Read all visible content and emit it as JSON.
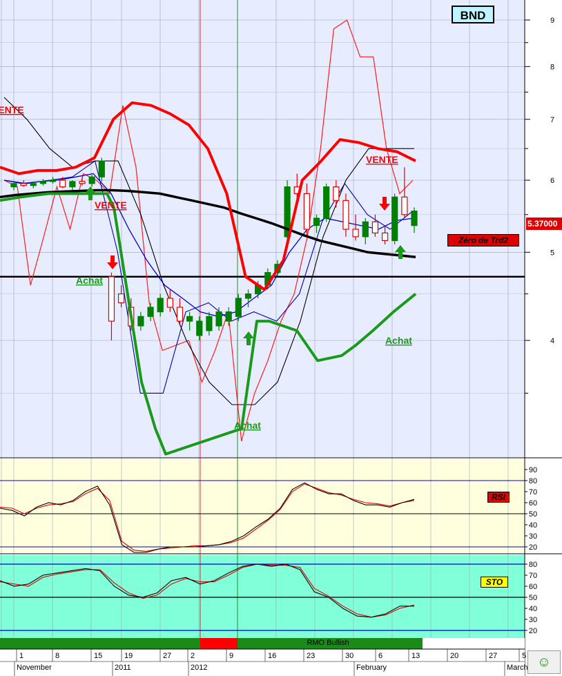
{
  "ticker": "BND",
  "last_price_label": "5.37000",
  "zero_label": "Zéro de Trd2",
  "rsi_label": "RSI",
  "sto_label": "STO",
  "rmo_label": "RMO Bullish",
  "signal_labels": {
    "vente": "VENTE",
    "achat": "Achat"
  },
  "colors": {
    "price_bg": "#e8ecff",
    "rsi_bg": "#ffffdd",
    "sto_bg": "#80ffd8",
    "bull": "#008000",
    "bear": "#e00000",
    "ma_black": "#000000",
    "ma_blue": "#0000cc"
  },
  "x_axis": {
    "ticks": [
      "1",
      "8",
      "15",
      "19",
      "27",
      "2",
      "9",
      "16",
      "23",
      "30",
      "6",
      "13",
      "20",
      "27",
      "5"
    ],
    "months": [
      "November",
      "2011",
      "2012",
      "February",
      "March"
    ]
  },
  "chart_data": [
    {
      "type": "line",
      "panel": "price",
      "title": "BND",
      "y_scale": "log",
      "ylim": [
        3.3,
        9.5
      ],
      "y_ticks": [
        4,
        5,
        6,
        7,
        8,
        9
      ],
      "last_price": 5.37,
      "support_level": 4.7,
      "candles": [
        [
          5.9,
          5.98,
          5.85,
          5.95
        ],
        [
          5.95,
          6.0,
          5.9,
          5.92
        ],
        [
          5.92,
          5.98,
          5.88,
          5.95
        ],
        [
          5.95,
          6.02,
          5.92,
          5.98
        ],
        [
          5.98,
          6.05,
          5.95,
          6.0
        ],
        [
          6.0,
          6.05,
          5.88,
          5.9
        ],
        [
          5.9,
          6.0,
          5.85,
          5.98
        ],
        [
          5.98,
          6.05,
          5.92,
          5.95
        ],
        [
          5.95,
          6.08,
          5.9,
          6.05
        ],
        [
          6.05,
          6.35,
          5.98,
          6.3
        ],
        [
          4.7,
          4.75,
          4.0,
          4.2
        ],
        [
          4.5,
          4.6,
          4.35,
          4.4
        ],
        [
          4.35,
          4.45,
          4.1,
          4.15
        ],
        [
          4.15,
          4.3,
          4.1,
          4.25
        ],
        [
          4.25,
          4.4,
          4.2,
          4.35
        ],
        [
          4.3,
          4.5,
          4.25,
          4.45
        ],
        [
          4.45,
          4.55,
          4.3,
          4.35
        ],
        [
          4.35,
          4.45,
          4.15,
          4.2
        ],
        [
          4.2,
          4.3,
          4.1,
          4.25
        ],
        [
          4.05,
          4.25,
          4.0,
          4.2
        ],
        [
          4.1,
          4.3,
          4.05,
          4.25
        ],
        [
          4.15,
          4.35,
          4.1,
          4.3
        ],
        [
          4.2,
          4.35,
          4.15,
          4.3
        ],
        [
          4.25,
          4.5,
          4.2,
          4.45
        ],
        [
          4.45,
          4.55,
          4.35,
          4.5
        ],
        [
          4.5,
          4.65,
          4.45,
          4.6
        ],
        [
          4.6,
          4.8,
          4.55,
          4.75
        ],
        [
          4.75,
          4.9,
          4.7,
          4.85
        ],
        [
          5.2,
          6.0,
          5.1,
          5.9
        ],
        [
          5.9,
          6.1,
          5.7,
          5.8
        ],
        [
          5.8,
          5.95,
          5.2,
          5.3
        ],
        [
          5.35,
          5.5,
          5.25,
          5.45
        ],
        [
          5.45,
          5.95,
          5.4,
          5.9
        ],
        [
          5.9,
          6.0,
          5.6,
          5.7
        ],
        [
          5.7,
          5.8,
          5.2,
          5.3
        ],
        [
          5.3,
          5.5,
          5.15,
          5.2
        ],
        [
          5.2,
          5.45,
          5.1,
          5.4
        ],
        [
          5.4,
          5.5,
          5.2,
          5.25
        ],
        [
          5.25,
          5.35,
          5.1,
          5.15
        ],
        [
          5.15,
          5.8,
          5.1,
          5.75
        ],
        [
          5.75,
          6.2,
          5.45,
          5.5
        ],
        [
          5.35,
          5.6,
          5.25,
          5.55
        ]
      ],
      "series": [
        {
          "role": "sma-long",
          "values": [
            5.75,
            5.78,
            5.8,
            5.82,
            5.83,
            5.84,
            5.85,
            5.85,
            5.84,
            5.82,
            5.8,
            5.75,
            5.7,
            5.65,
            5.6,
            5.52,
            5.45,
            5.38,
            5.3,
            5.22,
            5.15,
            5.1,
            5.05,
            5.0,
            4.98,
            4.96,
            4.94
          ]
        },
        {
          "role": "resistance-red-bold",
          "values": [
            6.2,
            6.1,
            6.15,
            6.15,
            6.2,
            6.35,
            7.0,
            7.3,
            7.25,
            7.1,
            6.9,
            6.5,
            5.8,
            4.7,
            4.55,
            4.9,
            6.0,
            6.3,
            6.65,
            6.6,
            6.5,
            6.45,
            6.3
          ]
        },
        {
          "role": "support-green-bold",
          "values": [
            5.7,
            5.75,
            5.8,
            5.8,
            5.8,
            5.8,
            5.6,
            3.6,
            3.2,
            3.0,
            3.2,
            4.2,
            4.2,
            4.1,
            3.8,
            3.85,
            3.95,
            4.1,
            4.3,
            4.5
          ]
        },
        {
          "role": "oscillator-red-thin",
          "values": [
            6.0,
            5.9,
            4.6,
            5.2,
            5.9,
            5.3,
            6.1,
            6.0,
            5.8,
            7.25,
            6.2,
            4.4,
            3.9,
            3.95,
            4.0,
            3.6,
            3.9,
            4.3,
            3.1,
            3.5,
            3.8,
            4.2,
            4.5,
            5.2,
            6.5,
            8.8,
            9.0,
            8.2,
            8.2,
            6.5,
            5.8,
            6.0
          ]
        },
        {
          "role": "ma-blue",
          "values": [
            6.0,
            5.95,
            5.98,
            6.0,
            6.05,
            6.1,
            5.8,
            5.3,
            4.9,
            4.6,
            4.45,
            4.3,
            4.25,
            4.3,
            4.45,
            4.6,
            5.0,
            5.3,
            5.45,
            5.4,
            5.35,
            5.3,
            5.42,
            5.45
          ]
        },
        {
          "role": "oscillator-black",
          "values": [
            7.4,
            7.0,
            6.5,
            6.2,
            6.3,
            6.3,
            5.5,
            4.6,
            4.0,
            3.6,
            3.4,
            3.4,
            3.6,
            4.2,
            5.2,
            6.0,
            6.5,
            6.5,
            6.5
          ]
        },
        {
          "role": "oscillator-blue-thin",
          "values": [
            6.0,
            5.95,
            6.0,
            6.05,
            6.3,
            5.0,
            3.5,
            3.5,
            4.3,
            4.4,
            4.2,
            4.3,
            4.2,
            4.5,
            5.4,
            5.95,
            5.5,
            5.3,
            5.55
          ]
        }
      ],
      "signals": [
        {
          "kind": "sell-arrow",
          "date_index": 10
        },
        {
          "kind": "buy-arrow",
          "date_index": 9
        },
        {
          "kind": "buy-arrow",
          "date_index": 26
        },
        {
          "kind": "sell-arrow",
          "date_index": 38
        },
        {
          "kind": "buy-arrow",
          "date_index": 40
        }
      ]
    },
    {
      "type": "line",
      "panel": "rsi",
      "title": "RSI",
      "ylim": [
        10,
        90
      ],
      "y_ticks": [
        20,
        30,
        40,
        50,
        60,
        70,
        80,
        90
      ],
      "levels": [
        20,
        50,
        80
      ],
      "series": [
        {
          "role": "rsi-black",
          "values": [
            55,
            53,
            48,
            56,
            60,
            58,
            62,
            70,
            75,
            58,
            22,
            15,
            15,
            18,
            20,
            20,
            20,
            21,
            22,
            25,
            30,
            38,
            45,
            55,
            72,
            78,
            72,
            68,
            68,
            62,
            58,
            58,
            56,
            60,
            63
          ]
        },
        {
          "role": "rsi-red",
          "values": [
            56,
            55,
            50,
            55,
            58,
            59,
            61,
            68,
            73,
            62,
            25,
            17,
            16,
            18,
            19,
            20,
            21,
            21,
            22,
            24,
            28,
            36,
            44,
            54,
            70,
            77,
            73,
            69,
            67,
            63,
            60,
            59,
            57,
            60,
            62
          ]
        }
      ]
    },
    {
      "type": "line",
      "panel": "sto",
      "title": "STO",
      "ylim": [
        10,
        85
      ],
      "y_ticks": [
        20,
        30,
        40,
        50,
        60,
        70,
        80
      ],
      "levels": [
        20,
        50,
        80
      ],
      "series": [
        {
          "role": "sto-black",
          "values": [
            65,
            60,
            62,
            70,
            72,
            74,
            76,
            74,
            60,
            52,
            50,
            54,
            65,
            68,
            62,
            65,
            72,
            78,
            80,
            78,
            80,
            75,
            55,
            50,
            40,
            33,
            32,
            35,
            42,
            42
          ]
        },
        {
          "role": "sto-red",
          "values": [
            64,
            62,
            60,
            68,
            71,
            73,
            75,
            75,
            63,
            54,
            49,
            52,
            62,
            67,
            64,
            64,
            70,
            77,
            80,
            79,
            79,
            77,
            58,
            51,
            42,
            35,
            32,
            34,
            40,
            43
          ]
        }
      ]
    },
    {
      "type": "bar",
      "panel": "rmo",
      "title": "RMO Bullish",
      "segments": [
        {
          "state": "bullish",
          "from_index": 0,
          "to_index": 11
        },
        {
          "state": "bearish",
          "from_index": 12,
          "to_index": 14
        },
        {
          "state": "bullish",
          "from_index": 15,
          "to_index": 42
        }
      ]
    }
  ]
}
